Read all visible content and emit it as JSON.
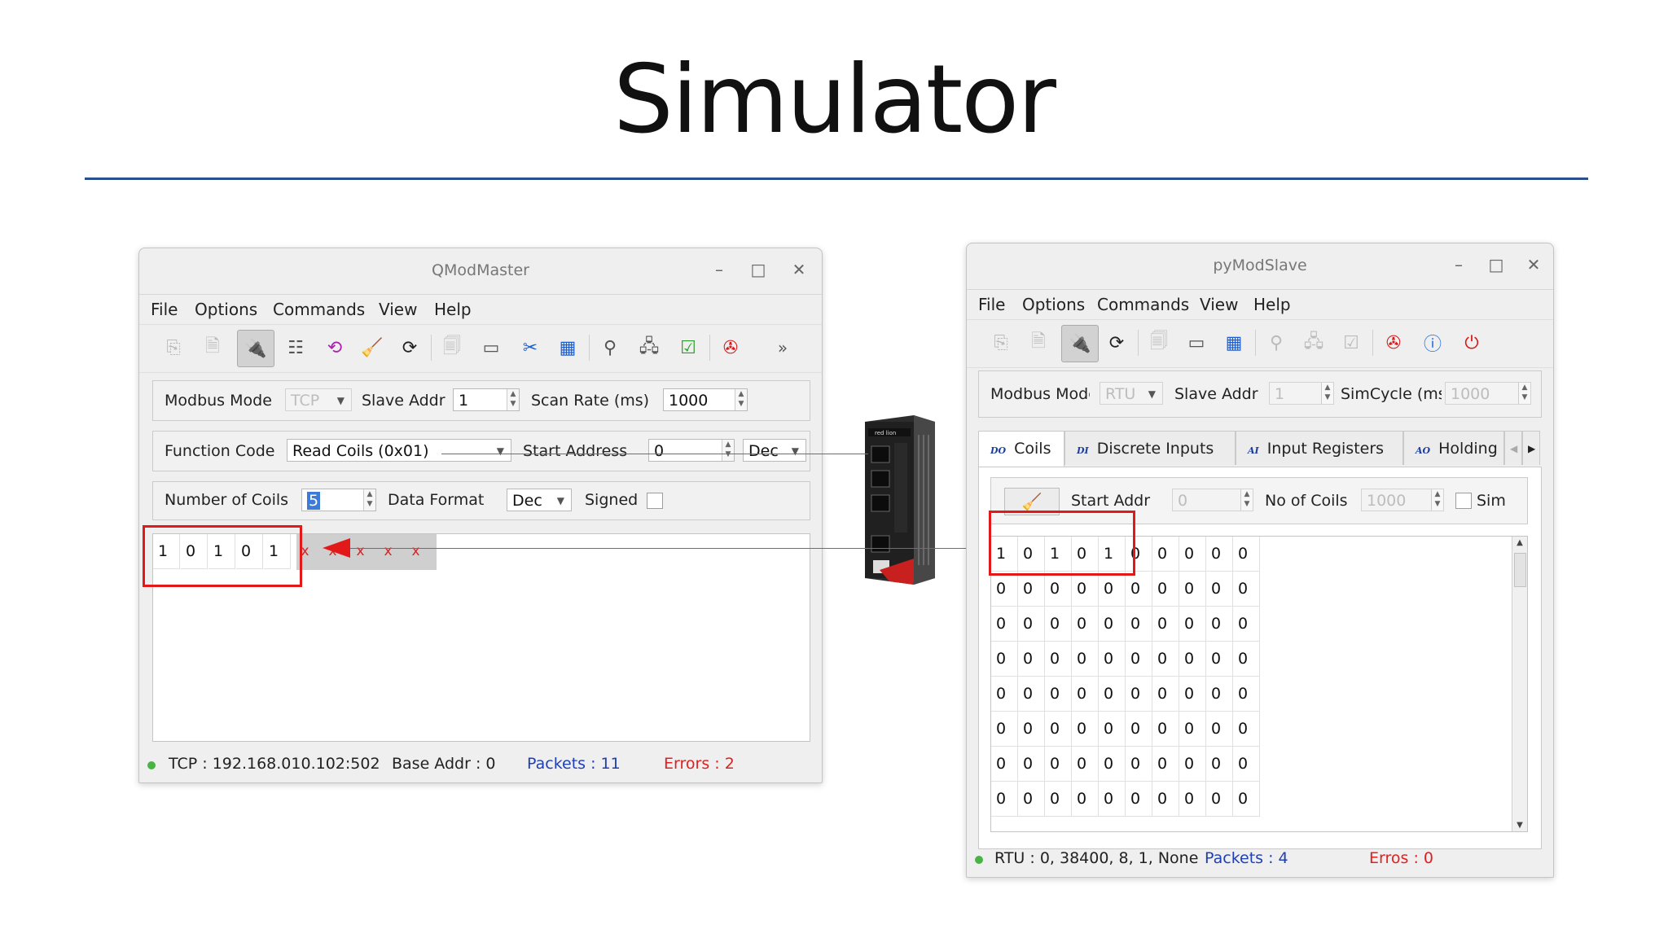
{
  "slide": {
    "title": "Simulator"
  },
  "qmodmaster": {
    "title": "QModMaster",
    "menu": [
      "File",
      "Options",
      "Commands",
      "View",
      "Help"
    ],
    "overflow": "»",
    "mode_label": "Modbus Mode",
    "mode_value": "TCP",
    "slave_label": "Slave Addr",
    "slave_value": "1",
    "scan_label": "Scan Rate (ms)",
    "scan_value": "1000",
    "function_label": "Function Code",
    "function_value": "Read Coils (0x01)",
    "start_label": "Start Address",
    "start_value": "0",
    "start_format": "Dec",
    "coils_label": "Number of Coils",
    "coils_value": "5",
    "data_format_label": "Data Format",
    "data_format_value": "Dec",
    "signed_label": "Signed",
    "cells": [
      "1",
      "0",
      "1",
      "0",
      "1"
    ],
    "x_marks": [
      "x",
      "x",
      "x",
      "x",
      "x"
    ],
    "status": {
      "conn": "TCP : 192.168.010.102:502",
      "base": "Base Addr : 0",
      "packets": "Packets : 11",
      "errors": "Errors : 2"
    }
  },
  "pymodslave": {
    "title": "pyModSlave",
    "menu": [
      "File",
      "Options",
      "Commands",
      "View",
      "Help"
    ],
    "mode_label": "Modbus Mode",
    "mode_value": "RTU",
    "slave_label": "Slave Addr",
    "slave_value": "1",
    "simcycle_label": "SimCycle (ms)",
    "simcycle_value": "1000",
    "tabs": [
      {
        "icon": "DO",
        "label": "Coils"
      },
      {
        "icon": "DI",
        "label": "Discrete Inputs"
      },
      {
        "icon": "AI",
        "label": "Input Registers"
      },
      {
        "icon": "AO",
        "label": "Holding Registers"
      }
    ],
    "start_label": "Start Addr",
    "start_value": "0",
    "coils_label": "No of Coils",
    "coils_value": "1000",
    "sim_label": "Sim",
    "rows": [
      [
        "1",
        "0",
        "1",
        "0",
        "1",
        "0",
        "0",
        "0",
        "0",
        "0"
      ],
      [
        "0",
        "0",
        "0",
        "0",
        "0",
        "0",
        "0",
        "0",
        "0",
        "0"
      ],
      [
        "0",
        "0",
        "0",
        "0",
        "0",
        "0",
        "0",
        "0",
        "0",
        "0"
      ],
      [
        "0",
        "0",
        "0",
        "0",
        "0",
        "0",
        "0",
        "0",
        "0",
        "0"
      ],
      [
        "0",
        "0",
        "0",
        "0",
        "0",
        "0",
        "0",
        "0",
        "0",
        "0"
      ],
      [
        "0",
        "0",
        "0",
        "0",
        "0",
        "0",
        "0",
        "0",
        "0",
        "0"
      ],
      [
        "0",
        "0",
        "0",
        "0",
        "0",
        "0",
        "0",
        "0",
        "0",
        "0"
      ],
      [
        "0",
        "0",
        "0",
        "0",
        "0",
        "0",
        "0",
        "0",
        "0",
        "0"
      ]
    ],
    "status": {
      "conn": "RTU : 0, 38400, 8, 1, None",
      "packets": "Packets : 4",
      "errors": "Erros : 0"
    }
  },
  "colors": {
    "accent_rule": "#2a4f8f",
    "highlight": "#e31919",
    "packets": "#1f3fb5",
    "errors": "#e02020",
    "online": "#49b443"
  }
}
